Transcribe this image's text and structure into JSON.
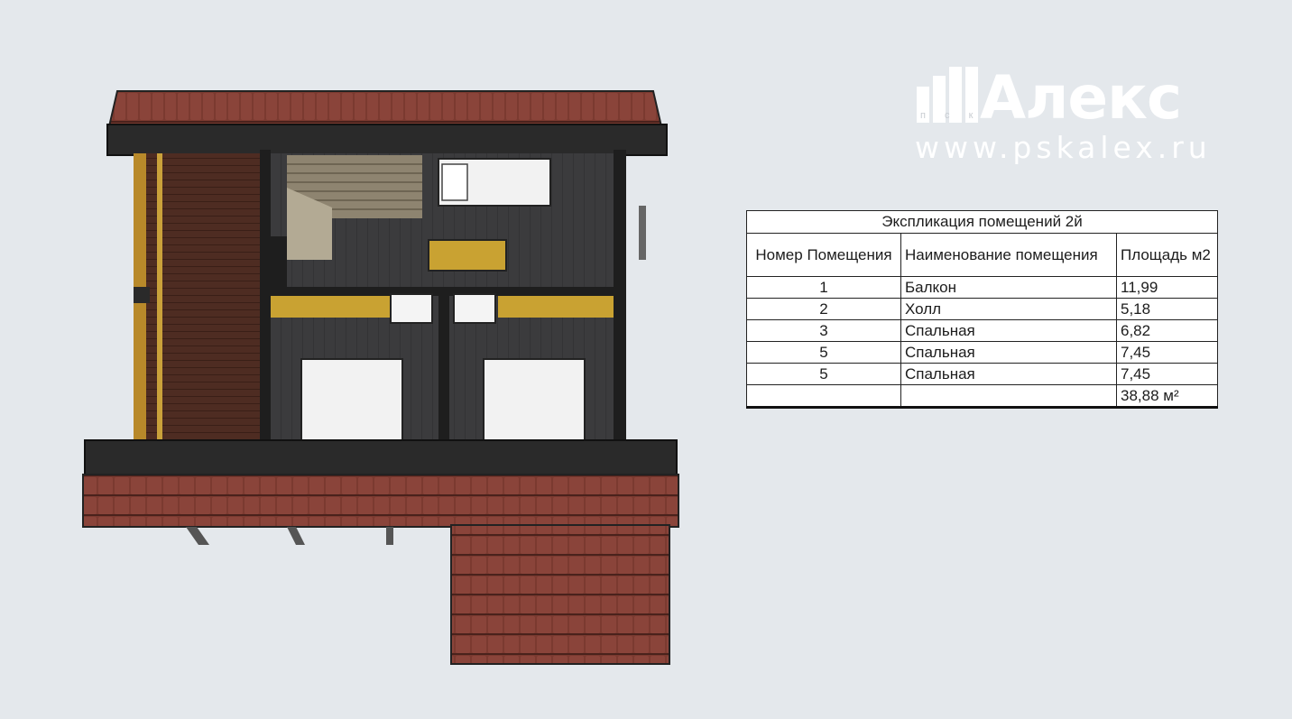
{
  "logo": {
    "brand": "Алекс",
    "prefix": "п с к",
    "url": "www.pskalex.ru"
  },
  "table": {
    "title": "Экспликация помещений 2й",
    "headers": [
      "Номер Помещения",
      "Наименование помещения",
      "Площадь м2"
    ],
    "rows": [
      {
        "num": "1",
        "name": "Балкон",
        "area": "11,99"
      },
      {
        "num": "2",
        "name": "Холл",
        "area": "5,18"
      },
      {
        "num": "3",
        "name": "Спальная",
        "area": "6,82"
      },
      {
        "num": "5",
        "name": "Спальная",
        "area": "7,45"
      },
      {
        "num": "5",
        "name": "Спальная",
        "area": "7,45"
      }
    ],
    "total": "38,88 м²"
  },
  "colors": {
    "roof": "#7a3a30",
    "floor_dark": "#3a3a3c",
    "balcony_floor": "#4e2c22",
    "wall": "#1e1e1e",
    "yellow": "#c9a232",
    "bed": "#f2f2f2"
  }
}
